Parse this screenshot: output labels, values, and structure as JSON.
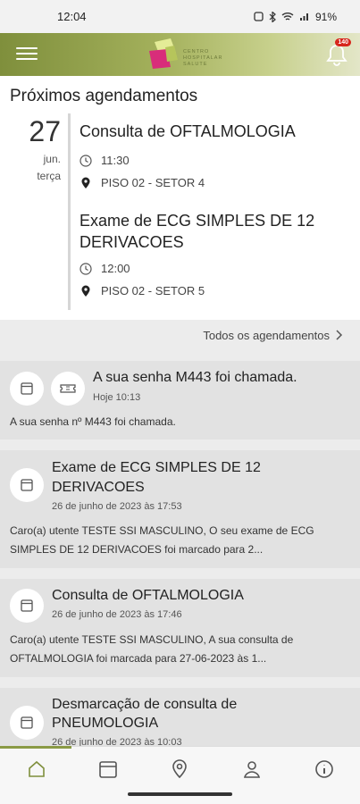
{
  "status_bar": {
    "time": "12:04",
    "battery": "91%"
  },
  "header": {
    "logo_lines": [
      "CENTRO",
      "HOSPITALAR",
      "SALUTE"
    ],
    "badge_count": "140"
  },
  "upcoming": {
    "title": "Próximos agendamentos",
    "date": {
      "day": "27",
      "month": "jun.",
      "weekday": "terça"
    },
    "appointments": [
      {
        "title": "Consulta de OFTALMOLOGIA",
        "time": "11:30",
        "location": "PISO 02 - SETOR 4"
      },
      {
        "title_line1": "Exame de ECG SIMPLES DE 12",
        "title_line2": "DERIVACOES",
        "time": "12:00",
        "location": "PISO 02 - SETOR 5"
      }
    ],
    "all_link": "Todos os agendamentos"
  },
  "notifications": [
    {
      "title": "A sua senha M443 foi chamada.",
      "date": "Hoje 10:13",
      "body": "A sua senha nº M443 foi chamada."
    },
    {
      "title_line1": "Exame de ECG SIMPLES DE 12",
      "title_line2": "DERIVACOES",
      "date": "26 de junho de 2023 às 17:53",
      "body_line1": "Caro(a) utente TESTE SSI MASCULINO, O seu exame de ECG",
      "body_line2": "SIMPLES DE 12 DERIVACOES foi marcado para 2..."
    },
    {
      "title": "Consulta de OFTALMOLOGIA",
      "date": "26 de junho de 2023 às 17:46",
      "body_line1": "Caro(a) utente TESTE SSI MASCULINO, A sua consulta de",
      "body_line2": "OFTALMOLOGIA foi marcada para 27-06-2023 às 1..."
    },
    {
      "title_line1": "Desmarcação de consulta de",
      "title_line2": "PNEUMOLOGIA",
      "date": "26 de junho de 2023 às 10:03"
    }
  ],
  "nav": [
    "home-icon",
    "calendar-icon",
    "location-icon",
    "profile-icon",
    "info-icon"
  ],
  "colors": {
    "brand": "#8a9a45",
    "badge": "#d7261c"
  }
}
